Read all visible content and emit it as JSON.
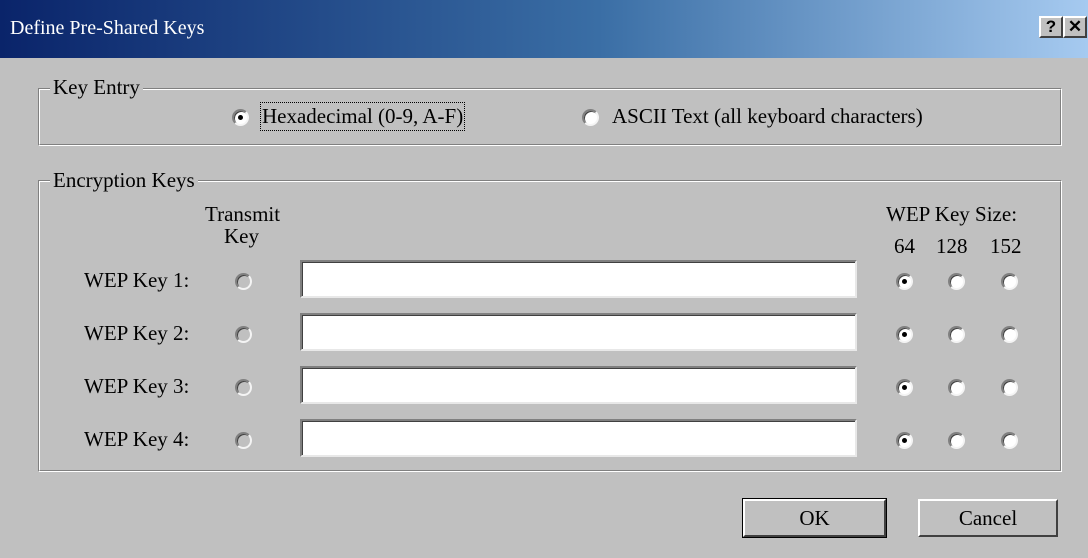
{
  "window": {
    "title": "Define Pre-Shared Keys",
    "help_label": "?",
    "close_label": "✕"
  },
  "key_entry": {
    "label": "Key Entry",
    "options": [
      {
        "label": "Hexadecimal (0-9, A-F)",
        "selected": true
      },
      {
        "label": "ASCII Text (all keyboard characters)",
        "selected": false
      }
    ]
  },
  "encryption": {
    "label": "Encryption Keys",
    "transmit_header_1": "Transmit",
    "transmit_header_2": "Key",
    "size_header": "WEP Key Size:",
    "sizes": [
      "64",
      "128",
      "152"
    ],
    "keys": [
      {
        "label": "WEP Key 1:",
        "value": "",
        "size": "64"
      },
      {
        "label": "WEP Key 2:",
        "value": "",
        "size": "64"
      },
      {
        "label": "WEP Key 3:",
        "value": "",
        "size": "64"
      },
      {
        "label": "WEP Key 4:",
        "value": "",
        "size": "64"
      }
    ]
  },
  "buttons": {
    "ok": "OK",
    "cancel": "Cancel"
  }
}
